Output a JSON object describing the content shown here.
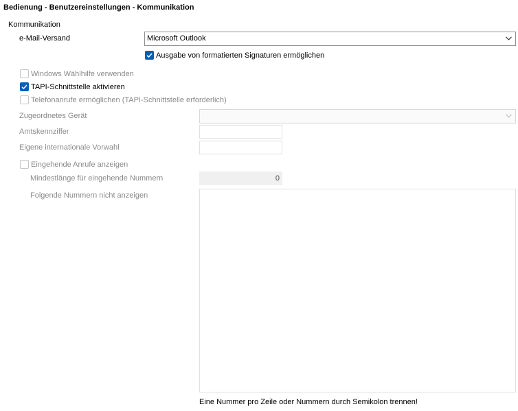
{
  "page_title": "Bedienung - Benutzereinstellungen - Kommunikation",
  "section_label": "Kommunikation",
  "email": {
    "label": "e-Mail-Versand",
    "selected_value": "Microsoft Outlook",
    "signatures_label": "Ausgabe von formatierten Signaturen ermöglichen",
    "signatures_checked": true
  },
  "windows_dialer": {
    "label": "Windows Wählhilfe verwenden",
    "checked": false,
    "enabled": false
  },
  "tapi": {
    "label": "TAPI-Schnittstelle aktivieren",
    "checked": true,
    "enabled": true
  },
  "phone_calls": {
    "label": "Telefonanrufe ermöglichen (TAPI-Schnittstelle erforderlich)",
    "checked": false,
    "enabled": false
  },
  "assigned_device": {
    "label": "Zugeordnetes Gerät",
    "value": ""
  },
  "exchange_code": {
    "label": "Amtskennziffer",
    "value": ""
  },
  "intl_prefix": {
    "label": "Eigene internationale Vorwahl",
    "value": ""
  },
  "incoming_calls": {
    "label": "Eingehende Anrufe anzeigen",
    "checked": false,
    "enabled": false
  },
  "min_length": {
    "label": "Mindestlänge für eingehende Nummern",
    "value": "0"
  },
  "hidden_numbers": {
    "label": "Folgende Nummern nicht anzeigen",
    "value": ""
  },
  "hint_text": "Eine Nummer pro Zeile oder Nummern durch Semikolon trennen!",
  "colors": {
    "accent": "#0a5fb4",
    "disabled_text": "#8a8a8a",
    "border": "#8f8f8f",
    "field_border": "#e0e0e0"
  }
}
